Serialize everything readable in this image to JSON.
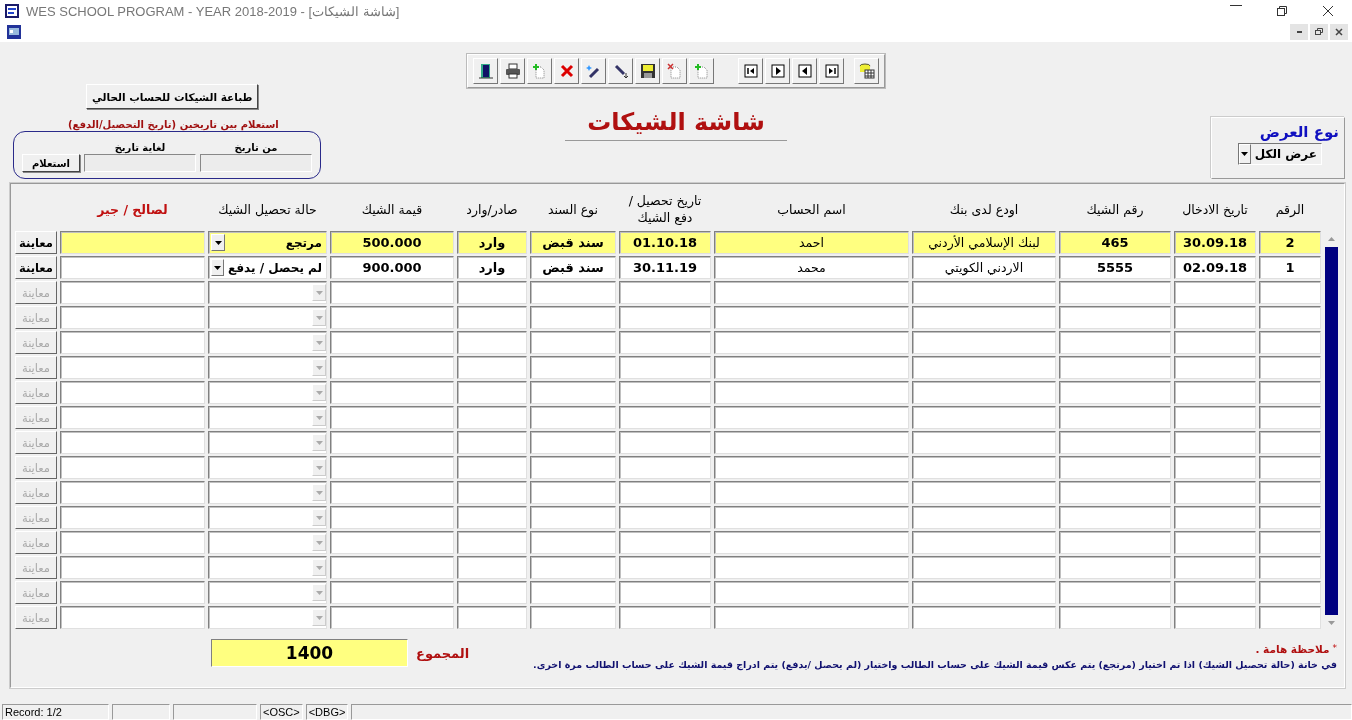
{
  "window": {
    "title": "WES SCHOOL PROGRAM - YEAR 2018-2019 - [شاشة الشيكات]"
  },
  "print_button": "طباعة الشيكات للحساب الحالي",
  "date_query": {
    "label": "استعلام بين تاريخين (تاريخ التحصيل/الدفع)",
    "from_label": "من تاريخ",
    "to_label": "لغاية تاريخ",
    "button": "استعلام"
  },
  "screen_title": "شاشة الشيكات",
  "display_type": {
    "label": "نوع العرض",
    "value": "عرض الكل"
  },
  "table": {
    "columns": [
      {
        "label": "الرقم",
        "kind": "text",
        "emphasis": false
      },
      {
        "label": "تاريخ الادخال",
        "kind": "text",
        "emphasis": false
      },
      {
        "label": "رقم الشيك",
        "kind": "text",
        "emphasis": false
      },
      {
        "label": "اودع لدى بنك",
        "kind": "text",
        "emphasis": false
      },
      {
        "label": "اسم الحساب",
        "kind": "text",
        "emphasis": false
      },
      {
        "label": "تاريخ تحصيل / دفع الشيك",
        "kind": "text",
        "emphasis": false
      },
      {
        "label": "نوع السند",
        "kind": "text",
        "emphasis": false
      },
      {
        "label": "صادر/وارد",
        "kind": "text",
        "emphasis": false
      },
      {
        "label": "قيمة الشيك",
        "kind": "text",
        "emphasis": false
      },
      {
        "label": "حالة تحصيل الشيك",
        "kind": "combo",
        "emphasis": false
      },
      {
        "label": "لصالح / جير",
        "kind": "text",
        "emphasis": true
      }
    ],
    "rows": [
      {
        "selected": true,
        "enabled": true,
        "view": "معاينة",
        "cells": [
          "2",
          "30.09.18",
          "465",
          "لبنك الإسلامي الأردني",
          "احمد",
          "01.10.18",
          "سند قبض",
          "وارد",
          "500.000",
          "مرتجع"
        ]
      },
      {
        "selected": false,
        "enabled": true,
        "view": "معاينة",
        "cells": [
          "1",
          "02.09.18",
          "5555",
          "الاردني الكويتي",
          "محمد",
          "30.11.19",
          "سند قبض",
          "وارد",
          "900.000",
          "لم يحصل / يدفع"
        ]
      },
      {
        "selected": false,
        "enabled": false,
        "view": "معاينة"
      },
      {
        "selected": false,
        "enabled": false,
        "view": "معاينة"
      },
      {
        "selected": false,
        "enabled": false,
        "view": "معاينة"
      },
      {
        "selected": false,
        "enabled": false,
        "view": "معاينة"
      },
      {
        "selected": false,
        "enabled": false,
        "view": "معاينة"
      },
      {
        "selected": false,
        "enabled": false,
        "view": "معاينة"
      },
      {
        "selected": false,
        "enabled": false,
        "view": "معاينة"
      },
      {
        "selected": false,
        "enabled": false,
        "view": "معاينة"
      },
      {
        "selected": false,
        "enabled": false,
        "view": "معاينة"
      },
      {
        "selected": false,
        "enabled": false,
        "view": "معاينة"
      },
      {
        "selected": false,
        "enabled": false,
        "view": "معاينة"
      },
      {
        "selected": false,
        "enabled": false,
        "view": "معاينة"
      },
      {
        "selected": false,
        "enabled": false,
        "view": "معاينة"
      },
      {
        "selected": false,
        "enabled": false,
        "view": "معاينة"
      }
    ]
  },
  "note": {
    "mark": "*",
    "title": "ملاحظة هامة .",
    "text": "في خانة (حالة تحصيل الشيك) اذا تم اختيار (مرتجع) يتم عكس قيمة الشيك على حساب الطالب واختيار (لم يحصل /يدفع) يتم ادراج قيمة الشيك على حساب الطالب مرة اخرى."
  },
  "total": {
    "label": "المجموع",
    "value": "1400"
  },
  "status_bar": {
    "record": "Record: 1/2",
    "osc": "<OSC>",
    "dbg": "<DBG>"
  }
}
